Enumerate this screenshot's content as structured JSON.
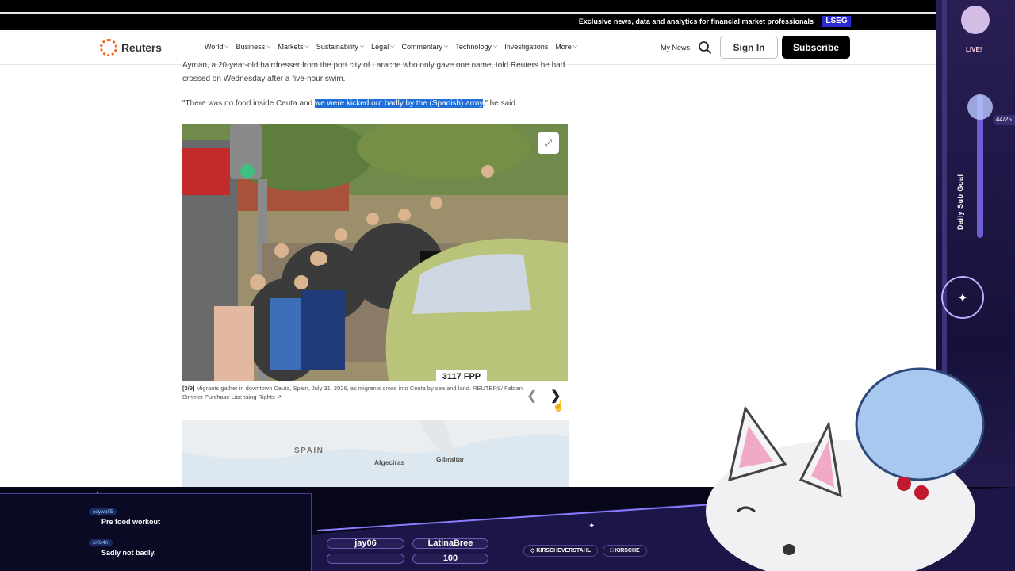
{
  "banner": {
    "promo": "Exclusive news, data and analytics for financial market professionals",
    "lseg": "LSEG"
  },
  "nav": {
    "logo": "Reuters",
    "items": [
      "World",
      "Business",
      "Markets",
      "Sustainability",
      "Legal",
      "Commentary",
      "Technology",
      "Investigations",
      "More"
    ],
    "my_news": "My News",
    "sign_in": "Sign In",
    "subscribe": "Subscribe"
  },
  "article": {
    "para1": "Ayman, a 20-year-old hairdresser from the port city of Larache who only gave one name, told Reuters he had crossed on Wednesday after a five-hour swim.",
    "para2_start": "\"There was no food inside Ceuta and ",
    "para2_highlight": "we were kicked out badly by the (Spanish) army",
    "para2_end": ",\" he said.",
    "caption_index": "[3/9]",
    "caption_text": " Migrants gather in downtown Ceuta, Spain, July 31, 2026, as migrants cross into Ceuta by sea and land. REUTERS/ Fabian Bimmer ",
    "caption_license": "Purchase Licensing Rights",
    "license_icon": "external-link-icon",
    "plate": "3117 FPP",
    "map_labels": {
      "spain": "SPAIN",
      "algeciras": "Algeciras",
      "gibraltar": "Gibraltar"
    }
  },
  "overlay": {
    "live": "LIVE!",
    "goal_label": "Daily Sub Goal",
    "goal_count": "44/25",
    "chat": [
      {
        "user": "coywolf5",
        "message": "Pre food workout"
      },
      {
        "user": "cr0z4n",
        "message": "Sadly not badly."
      }
    ],
    "bars": {
      "left_name": "jay06",
      "right_name": "LatinaBree",
      "value": "100"
    },
    "socials": {
      "twitter": "KIRSCHEVERSTAHL",
      "chat": "KIRSCHE"
    }
  },
  "colors": {
    "accent": "#f26522",
    "highlight": "#1f6fd8",
    "lseg": "#2b2bd6",
    "overlay": "#16113a"
  }
}
